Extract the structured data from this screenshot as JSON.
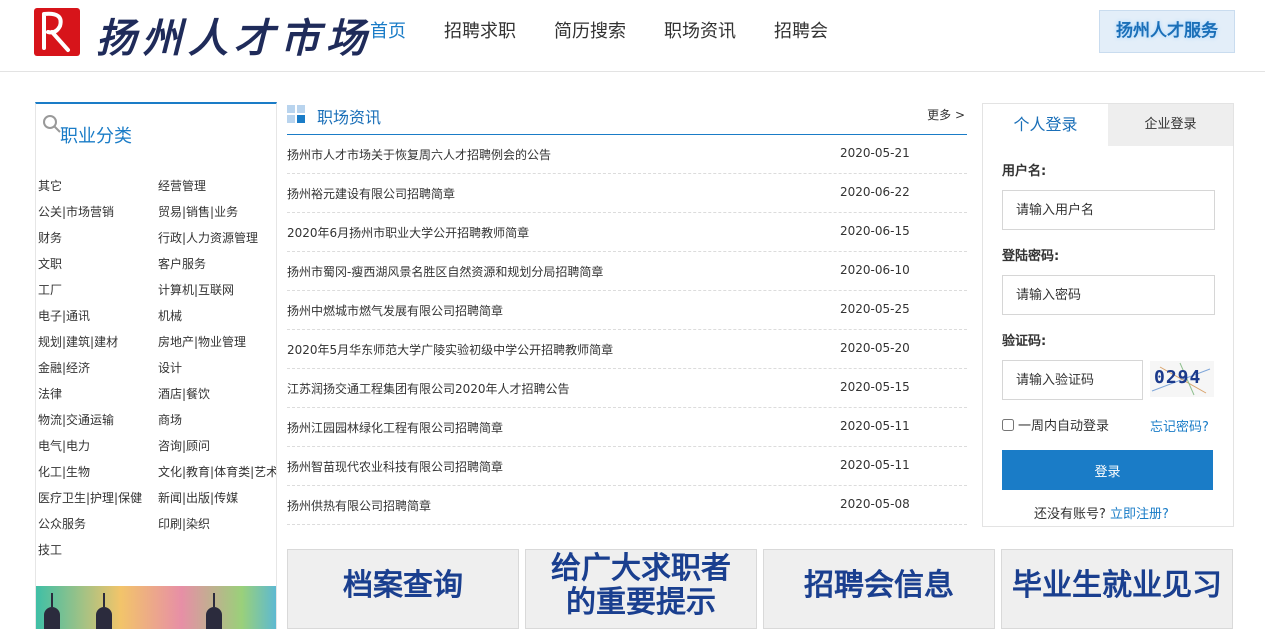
{
  "header": {
    "logo_text": "扬州人才市场",
    "nav": [
      "首页",
      "招聘求职",
      "简历搜索",
      "职场资讯",
      "招聘会"
    ],
    "active_nav": "首页",
    "service_badge": "扬州人才服务"
  },
  "categories": {
    "title": "职业分类",
    "rows": [
      [
        "其它",
        "经营管理"
      ],
      [
        "公关|市场营销",
        "贸易|销售|业务"
      ],
      [
        "财务",
        "行政|人力资源管理"
      ],
      [
        "文职",
        "客户服务"
      ],
      [
        "工厂",
        "计算机|互联网"
      ],
      [
        "电子|通讯",
        "机械"
      ],
      [
        "规划|建筑|建材",
        "房地产|物业管理"
      ],
      [
        "金融|经济",
        "设计"
      ],
      [
        "法律",
        "酒店|餐饮"
      ],
      [
        "物流|交通运输",
        "商场"
      ],
      [
        "电气|电力",
        "咨询|顾问"
      ],
      [
        "化工|生物",
        "文化|教育|体育类|艺术"
      ],
      [
        "医疗卫生|护理|保健",
        "新闻|出版|传媒"
      ],
      [
        "公众服务",
        "印刷|染织"
      ],
      [
        "技工",
        ""
      ]
    ]
  },
  "news": {
    "title": "职场资讯",
    "more": "更多 >",
    "items": [
      {
        "title": "扬州市人才市场关于恢复周六人才招聘例会的公告",
        "date": "2020-05-21"
      },
      {
        "title": "扬州裕元建设有限公司招聘简章",
        "date": "2020-06-22"
      },
      {
        "title": "2020年6月扬州市职业大学公开招聘教师简章",
        "date": "2020-06-15"
      },
      {
        "title": "扬州市蜀冈-瘦西湖风景名胜区自然资源和规划分局招聘简章",
        "date": "2020-06-10"
      },
      {
        "title": "扬州中燃城市燃气发展有限公司招聘简章",
        "date": "2020-05-25"
      },
      {
        "title": "2020年5月华东师范大学广陵实验初级中学公开招聘教师简章",
        "date": "2020-05-20"
      },
      {
        "title": "江苏润扬交通工程集团有限公司2020年人才招聘公告",
        "date": "2020-05-15"
      },
      {
        "title": "扬州江园园林绿化工程有限公司招聘简章",
        "date": "2020-05-11"
      },
      {
        "title": "扬州智苗现代农业科技有限公司招聘简章",
        "date": "2020-05-11"
      },
      {
        "title": "扬州供热有限公司招聘简章",
        "date": "2020-05-08"
      }
    ]
  },
  "login": {
    "tab_personal": "个人登录",
    "tab_company": "企业登录",
    "username_label": "用户名:",
    "username_placeholder": "请输入用户名",
    "password_label": "登陆密码:",
    "password_placeholder": "请输入密码",
    "captcha_label": "验证码:",
    "captcha_placeholder": "请输入验证码",
    "captcha_value": "0294",
    "remember_label": "一周内自动登录",
    "forgot_link": "忘记密码?",
    "login_button": "登录",
    "register_prompt": "还没有账号?",
    "register_link": "立即注册?"
  },
  "banners": {
    "archive": "档案查询",
    "tips_line1": "给广大求职者",
    "tips_line2": "的重要提示",
    "job_fair": "招聘会信息",
    "internship": "毕业生就业见习"
  },
  "colors": {
    "brand_blue": "#1a7cc7",
    "logo_red": "#d7141a",
    "banner_text": "#1a3f8f"
  }
}
